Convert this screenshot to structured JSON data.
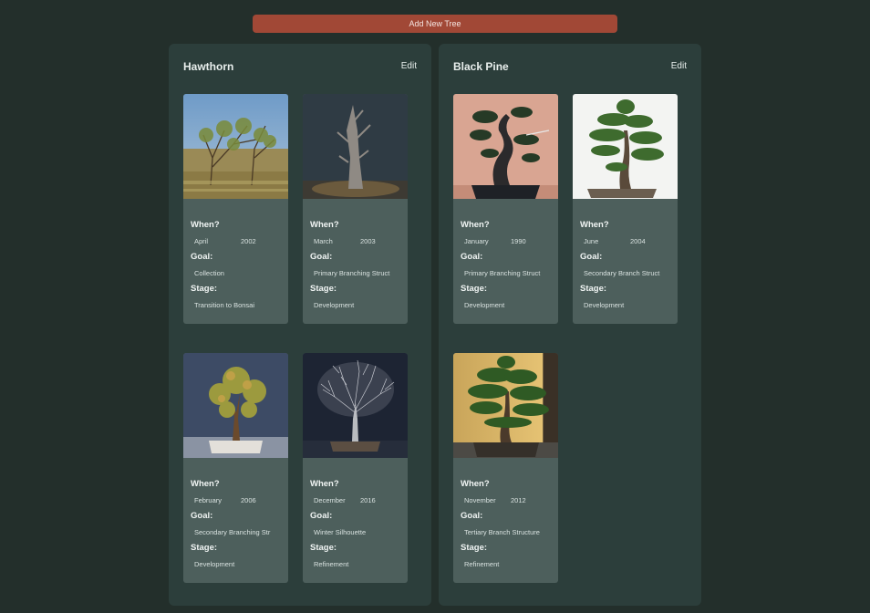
{
  "toolbar": {
    "add_label": "Add New Tree"
  },
  "trees": [
    {
      "name": "Hawthorn",
      "edit_label": "Edit",
      "entries": [
        {
          "labels": {
            "when": "When?",
            "goal": "Goal:",
            "stage": "Stage:"
          },
          "month": "April",
          "year": "2002",
          "goal": "Collection",
          "stage": "Transition to Bonsai"
        },
        {
          "labels": {
            "when": "When?",
            "goal": "Goal:",
            "stage": "Stage:"
          },
          "month": "March",
          "year": "2003",
          "goal": "Primary Branching Struct",
          "stage": "Development"
        },
        {
          "labels": {
            "when": "When?",
            "goal": "Goal:",
            "stage": "Stage:"
          },
          "month": "February",
          "year": "2006",
          "goal": "Secondary Branching Str",
          "stage": "Development"
        },
        {
          "labels": {
            "when": "When?",
            "goal": "Goal:",
            "stage": "Stage:"
          },
          "month": "December",
          "year": "2016",
          "goal": "Winter Silhouette",
          "stage": "Refinement"
        }
      ]
    },
    {
      "name": "Black Pine",
      "edit_label": "Edit",
      "entries": [
        {
          "labels": {
            "when": "When?",
            "goal": "Goal:",
            "stage": "Stage:"
          },
          "month": "January",
          "year": "1990",
          "goal": "Primary Branching Struct",
          "stage": "Development"
        },
        {
          "labels": {
            "when": "When?",
            "goal": "Goal:",
            "stage": "Stage:"
          },
          "month": "June",
          "year": "2004",
          "goal": "Secondary Branch Struct",
          "stage": "Development"
        },
        {
          "labels": {
            "when": "When?",
            "goal": "Goal:",
            "stage": "Stage:"
          },
          "month": "November",
          "year": "2012",
          "goal": "Tertiary Branch Structure",
          "stage": "Refinement"
        }
      ]
    }
  ]
}
